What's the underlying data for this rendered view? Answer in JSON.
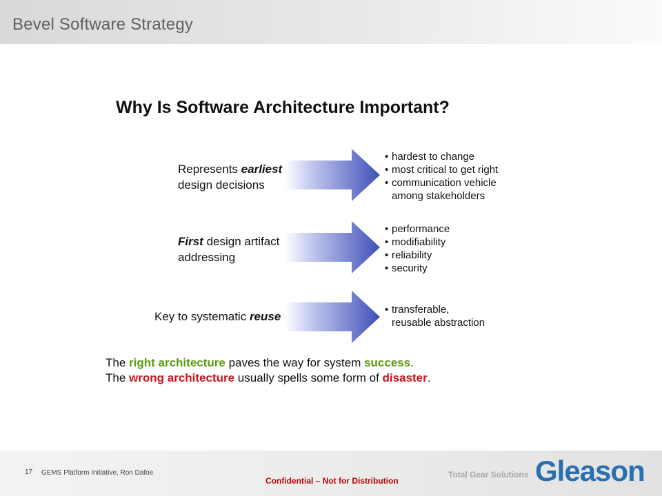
{
  "header": {
    "title": "Bevel Software Strategy"
  },
  "slide": {
    "title": "Why Is Software Architecture Important?",
    "rows": [
      {
        "left_pre": "Represents ",
        "left_emph": "earliest",
        "left_post": "design decisions",
        "bullets": [
          "hardest to change",
          "most critical to get right",
          "communication vehicle",
          "among stakeholders"
        ]
      },
      {
        "left_emph": "First",
        "left_post": " design artifact",
        "left_line2": "addressing",
        "bullets": [
          "performance",
          "modifiability",
          "reliability",
          "security"
        ]
      },
      {
        "left_pre": "Key to systematic ",
        "left_emph": "reuse",
        "bullets": [
          "transferable,",
          "reusable abstraction"
        ]
      }
    ],
    "summary": {
      "line1": {
        "t1": "The ",
        "hl1": "right architecture",
        "t2": " paves the way for system ",
        "hl2": "success",
        "t3": "."
      },
      "line2": {
        "t1": "The ",
        "hl1": "wrong architecture",
        "t2": " usually spells some form of ",
        "hl2": "disaster",
        "t3": "."
      }
    }
  },
  "footer": {
    "page_number": "17",
    "text": "GEMS  Platform Initiative,  Ron Dafoe",
    "confidential": "Confidential  – Not for Distribution",
    "tagline": "Total Gear Solutions",
    "logo": "Gleason"
  },
  "colors": {
    "green": "#5b9a12",
    "red": "#c8141c",
    "logo_blue": "#2a6fae",
    "arrow_start": "#ffffff",
    "arrow_end": "#3f4fb8"
  }
}
